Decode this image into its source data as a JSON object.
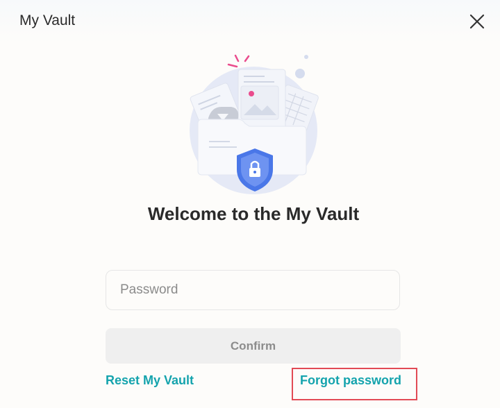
{
  "window": {
    "title": "My Vault"
  },
  "icons": {
    "close": "close-icon",
    "illustration": "vault-folder-shield-illustration"
  },
  "main": {
    "heading": "Welcome to the My Vault",
    "password": {
      "placeholder": "Password",
      "value": ""
    },
    "confirm_label": "Confirm",
    "reset_link": "Reset My Vault",
    "forgot_link": "Forgot password"
  },
  "colors": {
    "link": "#14a3ad",
    "highlight_box": "#e24a55",
    "shield": "#4a77e8"
  }
}
